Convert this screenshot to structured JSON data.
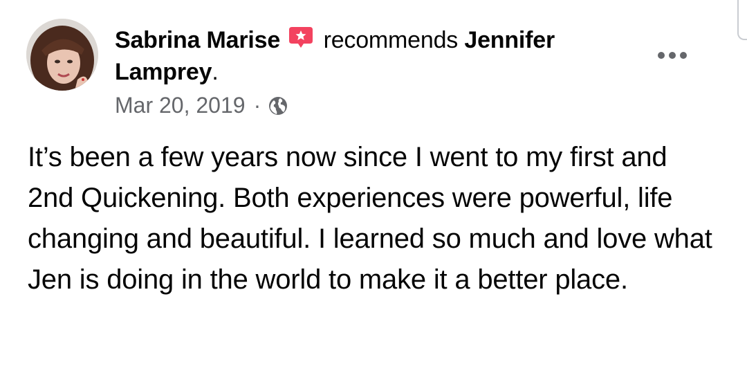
{
  "post": {
    "author": "Sabrina Marise",
    "action": "recommends",
    "page_line1": "Jennifer",
    "page_line2": "Lamprey",
    "page_suffix": ".",
    "date": "Mar 20, 2019",
    "separator": "·",
    "privacy_icon": "globe-icon",
    "recommend_icon": "recommendation-star-icon",
    "more_icon": "more-options-icon",
    "body": "It’s been a few years now since I went to my first and 2nd Quickening. Both experiences were powerful, life changing and beautiful. I learned so much and love what Jen is doing in the world to make it a better place."
  },
  "colors": {
    "text": "#050505",
    "secondary_text": "#65676b",
    "recommend_badge": "#f3425f",
    "background": "#ffffff"
  }
}
